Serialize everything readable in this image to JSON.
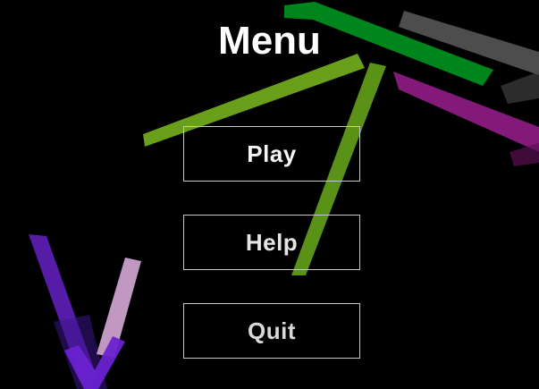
{
  "title": "Menu",
  "buttons": {
    "play": "Play",
    "help": "Help",
    "quit": "Quit"
  },
  "colors": {
    "background": "#000000",
    "text": "#ffffff",
    "button_border": "#c8c8c8",
    "streak_green": "#008c1e",
    "streak_lime": "#6fa81c",
    "streak_gray": "#5a5a5a",
    "streak_magenta": "#8a1a7e",
    "streak_purple": "#6420c8",
    "streak_pink": "#d6a8d6"
  }
}
